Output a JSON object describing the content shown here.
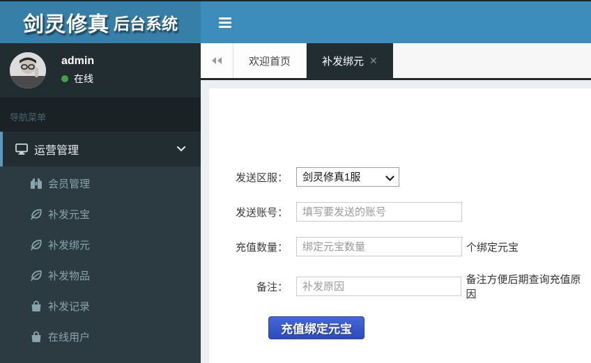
{
  "logo": {
    "title_main": "剑灵修真",
    "title_sub": "后台系统"
  },
  "navbar": {
    "hamburger_icon": "menu-icon"
  },
  "user": {
    "name": "admin",
    "status": "在线",
    "online_dot_color": "#42a145"
  },
  "sidebar": {
    "section_header": "导航菜单",
    "menu": {
      "icon": "desktop-icon",
      "label": "运营管理",
      "chevron": "chevron-down-icon",
      "active_border_color": "#5e97b9"
    },
    "submenu": [
      {
        "icon": "binoculars-icon",
        "label": "会员管理"
      },
      {
        "icon": "leaf-icon",
        "label": "补发元宝"
      },
      {
        "icon": "leaf-icon",
        "label": "补发绑元"
      },
      {
        "icon": "leaf-icon",
        "label": "补发物品"
      },
      {
        "icon": "shopping-bag-icon",
        "label": "补发记录"
      },
      {
        "icon": "shopping-bag-icon",
        "label": "在线用户"
      }
    ]
  },
  "tabs": {
    "back_icon": "backward-icon",
    "items": [
      {
        "label": "欢迎首页",
        "active": false
      },
      {
        "label": "补发绑元",
        "active": true,
        "close_icon": "✕"
      }
    ]
  },
  "form": {
    "server_row": {
      "label": "发送区服：",
      "value": "剑灵修真1服"
    },
    "account_row": {
      "label": "发送账号：",
      "placeholder": "填写要发送的账号"
    },
    "amount_row": {
      "label": "充值数量：",
      "placeholder": "绑定元宝数量",
      "suffix": "个绑定元宝"
    },
    "remark_row": {
      "label": "备注：",
      "placeholder": "补发原因",
      "suffix": "备注方便后期查询充值原因"
    },
    "submit_label": "充值绑定元宝"
  },
  "colors": {
    "navbar": "#3c8dbc",
    "logo_bg": "#367fa9",
    "sidebar_bg": "#222d32",
    "submenu_bg": "#2c3b41",
    "active_tab_bg": "#222d32",
    "button_blue": "#3350c8",
    "content_bg": "#ecf0f5"
  }
}
